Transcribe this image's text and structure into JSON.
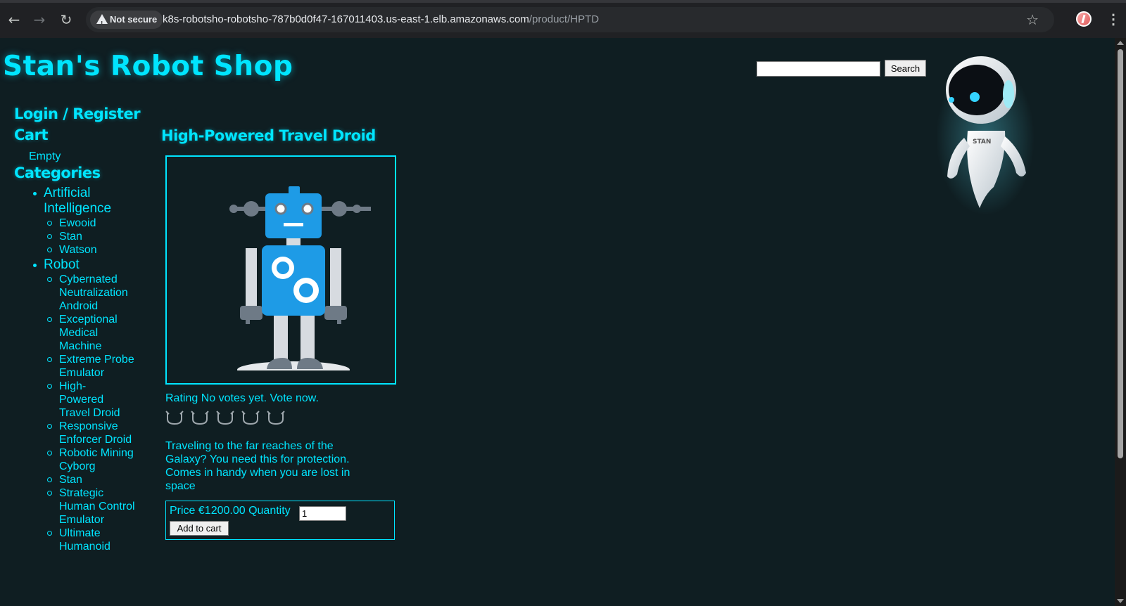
{
  "browser": {
    "security_label": "Not secure",
    "url_host": "k8s-robotsho-robotsho-787b0d0f47-167011403.us-east-1.elb.amazonaws.com",
    "url_path": "/product/HPTD",
    "icons": [
      "back-arrow-icon",
      "forward-arrow-icon",
      "reload-icon",
      "warning-icon",
      "star-icon",
      "profile-avatar",
      "kebab-menu-icon"
    ]
  },
  "site": {
    "title": "Stan's Robot Shop",
    "search_button": "Search",
    "search_value": ""
  },
  "sidebar": {
    "login": "Login / Register",
    "cart_heading": "Cart",
    "cart_status": "Empty",
    "categories_heading": "Categories",
    "categories": [
      {
        "name": "Artificial Intelligence",
        "items": [
          "Ewooid",
          "Stan",
          "Watson"
        ]
      },
      {
        "name": "Robot",
        "items": [
          "Cybernated Neutralization Android",
          "Exceptional Medical Machine",
          "Extreme Probe Emulator",
          "High-Powered Travel Droid",
          "Responsive Enforcer Droid",
          "Robotic Mining Cyborg",
          "Stan",
          "Strategic Human Control Emulator",
          "Ultimate Humanoid"
        ]
      }
    ]
  },
  "product": {
    "title": "High-Powered Travel Droid",
    "rating_text": "Rating No votes yet. Vote now.",
    "vote_count_icons": 5,
    "description": "Traveling to the far reaches of the Galaxy? You need this for protection. Comes in handy when you are lost in space",
    "price_text": "Price €1200.00 Quantity",
    "quantity": "1",
    "add_button": "Add to cart"
  },
  "colors": {
    "background": "#0f1e22",
    "accent": "#00e5ff",
    "robot_blue": "#1e9be6"
  }
}
